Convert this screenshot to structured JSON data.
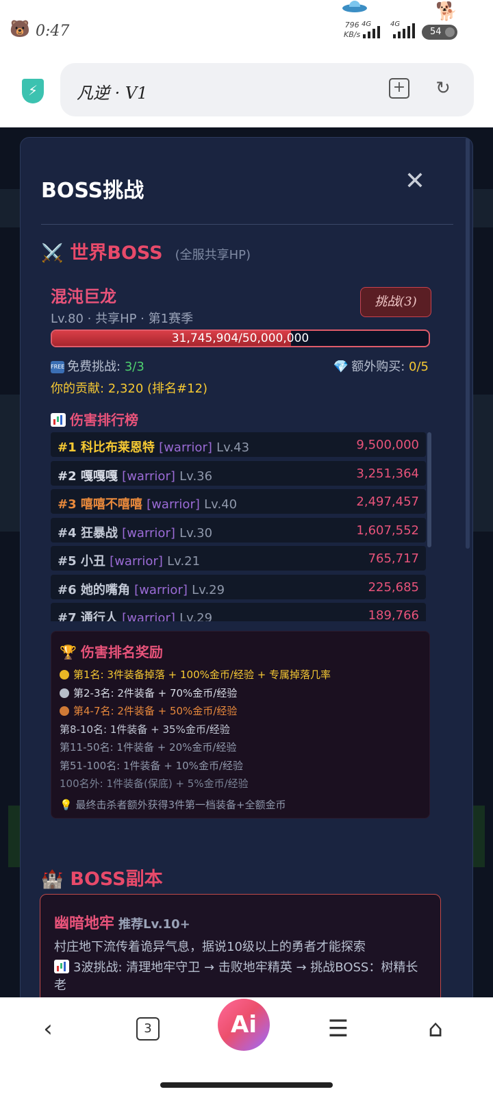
{
  "status_bar": {
    "time": "0:47",
    "net_rate_value": "796",
    "net_rate_unit": "KB/s",
    "signal1_label": "4G",
    "signal2_label": "4G",
    "battery": "54"
  },
  "browser": {
    "url_title": "凡逆 · V1"
  },
  "modal": {
    "title": "BOSS挑战",
    "close_glyph": "✕"
  },
  "world_boss": {
    "section_icon": "crossed-swords-icon",
    "section_title": "世界BOSS",
    "section_subtitle": "(全服共享HP)",
    "boss_name": "混沌巨龙",
    "boss_meta": "Lv.80 · 共享HP · 第1赛季",
    "challenge_button": "挑战(3)",
    "hp_text": "31,745,904/50,000,000",
    "hp_fraction": 0.635,
    "free_label": "免费挑战:",
    "free_value": "3/3",
    "extra_label": "额外购买:",
    "extra_value": "0/5",
    "contribution": "你的贡献: 2,320 (排名#12)"
  },
  "leaderboard": {
    "title": "伤害排行榜",
    "rows": [
      {
        "rank": "#1",
        "name": "科比布莱恩特",
        "cls": "[warrior]",
        "level": "Lv.43",
        "damage": "9,500,000",
        "color": "#f6c933"
      },
      {
        "rank": "#2",
        "name": "嘎嘎嘎",
        "cls": "[warrior]",
        "level": "Lv.36",
        "damage": "3,251,364",
        "color": "#d8dce6"
      },
      {
        "rank": "#3",
        "name": "嘻嘻不嘻嘻",
        "cls": "[warrior]",
        "level": "Lv.40",
        "damage": "2,497,457",
        "color": "#e8893c"
      },
      {
        "rank": "#4",
        "name": "狂暴战",
        "cls": "[warrior]",
        "level": "Lv.30",
        "damage": "1,607,552",
        "color": "#c3c9d6"
      },
      {
        "rank": "#5",
        "name": "小丑",
        "cls": "[warrior]",
        "level": "Lv.21",
        "damage": "765,717",
        "color": "#c3c9d6"
      },
      {
        "rank": "#6",
        "name": "她的嘴角",
        "cls": "[warrior]",
        "level": "Lv.29",
        "damage": "225,685",
        "color": "#c3c9d6"
      },
      {
        "rank": "#7",
        "name": "通行人",
        "cls": "[warrior]",
        "level": "Lv.29",
        "damage": "189,766",
        "color": "#c3c9d6"
      }
    ]
  },
  "rewards": {
    "title": "伤害排名奖励",
    "lines": [
      {
        "text": "第1名: 3件装备掉落 + 100%金币/经验 + 专属掉落几率",
        "color": "#f6c933",
        "medal": "#e9b625"
      },
      {
        "text": "第2-3名: 2件装备 + 70%金币/经验",
        "color": "#d8dce6",
        "medal": "#b8bec9"
      },
      {
        "text": "第4-7名: 2件装备 + 50%金币/经验",
        "color": "#e8893c",
        "medal": "#d07a36"
      },
      {
        "text": "第8-10名: 1件装备 + 35%金币/经验",
        "color": "#c3c9d6",
        "medal": ""
      },
      {
        "text": "第11-50名: 1件装备 + 20%金币/经验",
        "color": "#8f98ab",
        "medal": ""
      },
      {
        "text": "第51-100名: 1件装备 + 10%金币/经验",
        "color": "#8f98ab",
        "medal": ""
      },
      {
        "text": "100名外: 1件装备(保底) + 5%金币/经验",
        "color": "#7a8396",
        "medal": ""
      },
      {
        "text": "💡 最终击杀者额外获得3件第一档装备+全额金币",
        "color": "#8f98ab",
        "medal": ""
      }
    ]
  },
  "dungeon": {
    "section_icon": "castle-icon",
    "section_title": "BOSS副本",
    "card_name": "幽暗地牢",
    "card_recommend": "推荐Lv.10+",
    "card_desc": "村庄地下流传着诡异气息，据说10级以上的勇者才能探索",
    "card_waves": "3波挑战: 清理地牢守卫 → 击败地牢精英 → 挑战BOSS：树精长老"
  },
  "nav": {
    "back_icon": "back-chevron-icon",
    "tab_count": "3",
    "ai_label": "Ai",
    "menu_icon": "menu-icon",
    "home_icon": "home-icon"
  }
}
